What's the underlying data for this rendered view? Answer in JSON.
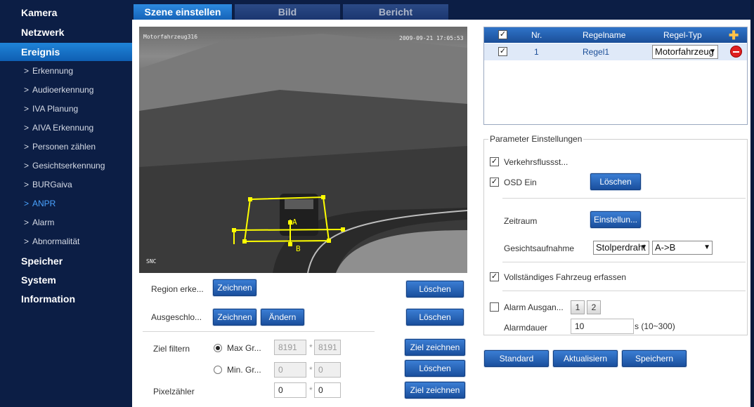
{
  "sidebar": {
    "items": [
      {
        "label": "Kamera"
      },
      {
        "label": "Netzwerk"
      },
      {
        "label": "Ereignis"
      },
      {
        "label": "Speicher"
      },
      {
        "label": "System"
      },
      {
        "label": "Information"
      }
    ],
    "subitems": [
      {
        "label": "Erkennung"
      },
      {
        "label": "Audioerkennung"
      },
      {
        "label": "IVA Planung"
      },
      {
        "label": "AIVA Erkennung"
      },
      {
        "label": "Personen zählen"
      },
      {
        "label": "Gesichtserkennung"
      },
      {
        "label": "BURGaiva"
      },
      {
        "label": "ANPR"
      },
      {
        "label": "Alarm"
      },
      {
        "label": "Abnormalität"
      }
    ],
    "chevron": ">"
  },
  "tabs": [
    {
      "label": "Szene einstellen"
    },
    {
      "label": "Bild"
    },
    {
      "label": "Bericht"
    }
  ],
  "video": {
    "channel": "Motorfahrzeug316",
    "timestamp": "2009-09-21 17:05:53",
    "corner": "SNC",
    "point_a": "A",
    "point_b": "B"
  },
  "controls": {
    "region_label": "Region erke...",
    "excluded_label": "Ausgeschlo...",
    "draw": "Zeichnen",
    "change": "Ändern",
    "delete": "Löschen",
    "filter_label": "Ziel filtern",
    "max_label": "Max Gr...",
    "min_label": "Min. Gr...",
    "max_w": "8191",
    "max_h": "8191",
    "min_w": "0",
    "min_h": "0",
    "times": "*",
    "draw_target": "Ziel zeichnen",
    "pixel_label": "Pixelzähler",
    "pixel_w": "0",
    "pixel_h": "0"
  },
  "rules": {
    "headers": {
      "nr": "Nr.",
      "name": "Regelname",
      "type": "Regel-Typ"
    },
    "rows": [
      {
        "nr": "1",
        "name": "Regel1",
        "type": "Motorfahrzeug"
      }
    ]
  },
  "params": {
    "legend": "Parameter Einstellungen",
    "traffic": "Verkehrsflussst...",
    "osd": "OSD Ein",
    "osd_delete": "Löschen",
    "period_label": "Zeitraum",
    "period_btn": "Einstellun...",
    "face_label": "Gesichtsaufnahme",
    "face_value": "Stolperdraht",
    "direction": "A->B",
    "full_vehicle": "Vollständiges Fahrzeug erfassen",
    "alarm_out": "Alarm Ausgan...",
    "alarm_page1": "1",
    "alarm_page2": "2",
    "alarm_duration_label": "Alarmdauer",
    "alarm_duration": "10",
    "alarm_range": "s (10~300)"
  },
  "footer": {
    "standard": "Standard",
    "refresh": "Aktualisiern",
    "save": "Speichern"
  },
  "colors": {
    "accent": "#1a67c2",
    "sidebar": "#0c1e45",
    "overlay": "#ffff00"
  }
}
